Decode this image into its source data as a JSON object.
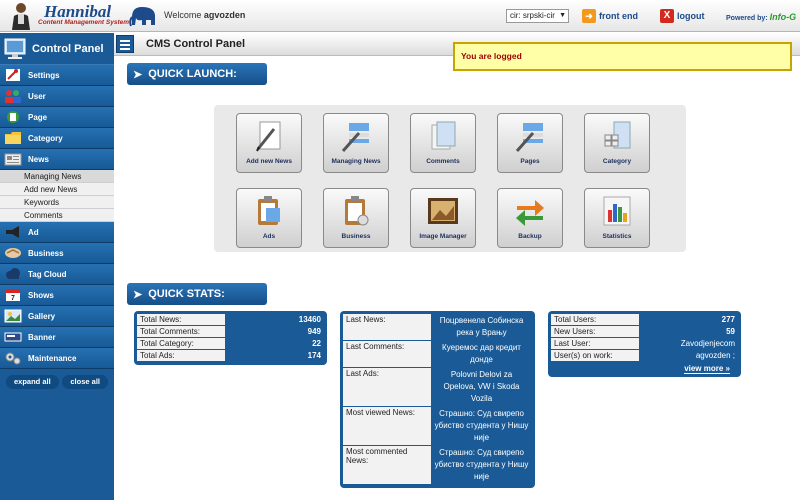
{
  "header": {
    "app_title": "Hannibal",
    "app_subtitle": "Content Management System",
    "welcome_prefix": "Welcome",
    "username": "agvozden",
    "language": "cir: srpski-cir",
    "front_end": "front end",
    "logout": "logout",
    "powered_by": "Powered by:",
    "powered_brand": "Info-G"
  },
  "sidebar": {
    "title": "Control Panel",
    "items": [
      {
        "label": "Settings",
        "icon": "wrench-icon"
      },
      {
        "label": "User",
        "icon": "users-icon"
      },
      {
        "label": "Page",
        "icon": "page-icon"
      },
      {
        "label": "Category",
        "icon": "folder-icon"
      },
      {
        "label": "News",
        "icon": "newspaper-icon"
      },
      {
        "label": "Ad",
        "icon": "megaphone-icon"
      },
      {
        "label": "Business",
        "icon": "handshake-icon"
      },
      {
        "label": "Tag Cloud",
        "icon": "cloud-icon"
      },
      {
        "label": "Shows",
        "icon": "calendar-icon"
      },
      {
        "label": "Gallery",
        "icon": "gallery-icon"
      },
      {
        "label": "Banner",
        "icon": "banner-icon"
      },
      {
        "label": "Maintenance",
        "icon": "gears-icon"
      }
    ],
    "news_sub": [
      "Managing News",
      "Add new News",
      "Keywords",
      "Comments"
    ],
    "expand_all": "expand all",
    "close_all": "close all"
  },
  "main": {
    "title": "CMS Control Panel",
    "notice": "You are logged",
    "quick_launch_title": "QUICK LAUNCH:",
    "quick_stats_title": "QUICK STATS:",
    "tiles": [
      {
        "label": "Add new News",
        "icon": "pen-paper-icon"
      },
      {
        "label": "Managing News",
        "icon": "pen-list-icon"
      },
      {
        "label": "Comments",
        "icon": "documents-icon"
      },
      {
        "label": "Pages",
        "icon": "pen-list-icon"
      },
      {
        "label": "Category",
        "icon": "grid-folder-icon"
      },
      {
        "label": "Ads",
        "icon": "clipboard-icon"
      },
      {
        "label": "Business",
        "icon": "clipboard-gear-icon"
      },
      {
        "label": "Image Manager",
        "icon": "picture-frame-icon"
      },
      {
        "label": "Backup",
        "icon": "sync-arrows-icon"
      },
      {
        "label": "Statistics",
        "icon": "bar-chart-icon"
      }
    ]
  },
  "stats_left": [
    {
      "label": "Total News:",
      "value": "13460"
    },
    {
      "label": "Total Comments:",
      "value": "949"
    },
    {
      "label": "Total Category:",
      "value": "22"
    },
    {
      "label": "Total Ads:",
      "value": "174"
    }
  ],
  "stats_mid": [
    {
      "label": "Last News:",
      "value": "Поцрвенела Собинска река у Врању"
    },
    {
      "label": "Last Comments:",
      "value": "Куеремос дар кредит донде"
    },
    {
      "label": "Last Ads:",
      "value": "Polovni Delovi za Opelova, VW i Skoda Vozila"
    },
    {
      "label": "Most viewed News:",
      "value": "Страшно: Суд свирепо убиство студента у Нишу није"
    },
    {
      "label": "Most commented News:",
      "value": "Страшно: Суд свирепо убиство студента у Нишу није"
    }
  ],
  "stats_right": [
    {
      "label": "Total Users:",
      "value": "277"
    },
    {
      "label": "New Users:",
      "value": "59"
    },
    {
      "label": "Last User:",
      "value": "Zavodjenjecom"
    },
    {
      "label": "User(s) on work:",
      "value": "agvozden ;"
    }
  ],
  "view_more": "view more »"
}
